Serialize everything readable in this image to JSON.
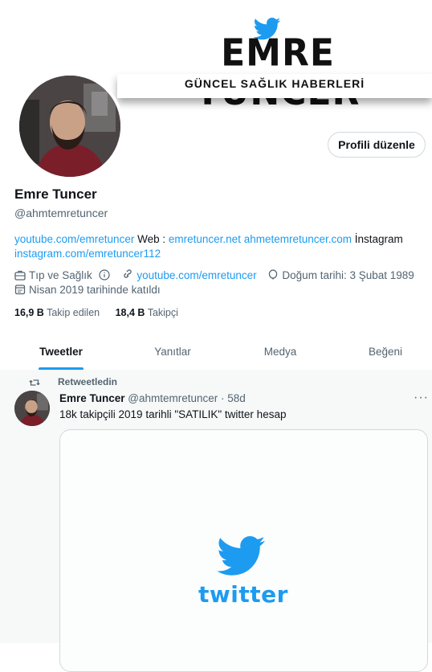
{
  "banner": {
    "title": "EMRE TUNCER",
    "subtitle": "GÜNCEL SAĞLIK HABERLERİ"
  },
  "profile": {
    "edit_button": "Profili düzenle",
    "name": "Emre Tuncer",
    "handle": "@ahmtemretuncer",
    "bio": {
      "link1": "youtube.com/emretuncer",
      "text1": " Web : ",
      "link2": "emretuncer.net",
      "link3": "ahmetemretuncer.com",
      "text2": " İnstagram",
      "link4": "instagram.com/emretuncer112"
    },
    "category": "Tıp ve Sağlık",
    "website": "youtube.com/emretuncer",
    "birthday": "Doğum tarihi: 3 Şubat 1989",
    "joined": "Nisan 2019 tarihinde katıldı",
    "following_count": "16,9 B",
    "following_label": "Takip edilen",
    "followers_count": "18,4 B",
    "followers_label": "Takipçi"
  },
  "tabs": [
    "Tweetler",
    "Yanıtlar",
    "Medya",
    "Beğeni"
  ],
  "tweet": {
    "retweet_label": "Retweetledin",
    "author": "Emre Tuncer",
    "handle_time": "@ahmtemretuncer · 58d",
    "text": "18k takipçili 2019 tarihli \"SATILIK\" twitter hesap",
    "media_word": "twitter"
  },
  "colors": {
    "accent": "#1d9bf0",
    "text": "#0f1419",
    "muted": "#536471",
    "border": "#cfd9de"
  }
}
